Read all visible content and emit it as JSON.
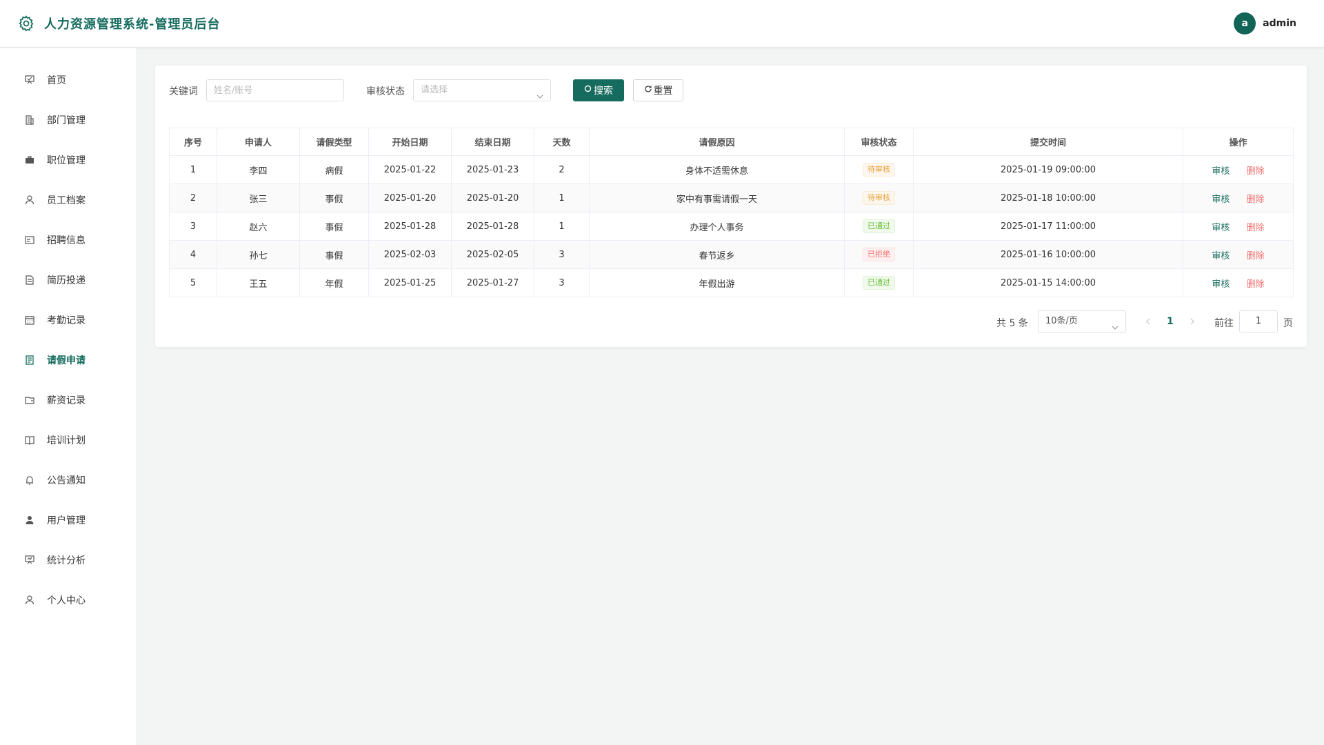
{
  "header": {
    "logo_icon": "gear-icon",
    "title": "人力资源管理系统-管理员后台",
    "avatar_letter": "a",
    "username": "admin"
  },
  "sidebar": {
    "items": [
      {
        "label": "首页",
        "icon": "presentation-board-icon"
      },
      {
        "label": "部门管理",
        "icon": "building-icon"
      },
      {
        "label": "职位管理",
        "icon": "briefcase-icon"
      },
      {
        "label": "员工档案",
        "icon": "user-icon"
      },
      {
        "label": "招聘信息",
        "icon": "postcard-icon"
      },
      {
        "label": "简历投递",
        "icon": "document-icon"
      },
      {
        "label": "考勤记录",
        "icon": "calendar-icon"
      },
      {
        "label": "请假申请",
        "icon": "tickets-icon",
        "active": true
      },
      {
        "label": "薪资记录",
        "icon": "wallet-icon"
      },
      {
        "label": "培训计划",
        "icon": "reading-icon"
      },
      {
        "label": "公告通知",
        "icon": "bell-icon"
      },
      {
        "label": "用户管理",
        "icon": "user-filled-icon"
      },
      {
        "label": "统计分析",
        "icon": "data-board-icon"
      },
      {
        "label": "个人中心",
        "icon": "user-icon"
      }
    ]
  },
  "filters": {
    "keyword_label": "关键词",
    "keyword_placeholder": "姓名/账号",
    "status_label": "审核状态",
    "status_placeholder": "请选择",
    "search_button": "搜索",
    "reset_button": "重置"
  },
  "table": {
    "columns": [
      "序号",
      "申请人",
      "请假类型",
      "开始日期",
      "结束日期",
      "天数",
      "请假原因",
      "审核状态",
      "提交时间",
      "操作"
    ],
    "rows": [
      {
        "index": "1",
        "applicant": "李四",
        "type": "病假",
        "start": "2025-01-22",
        "end": "2025-01-23",
        "days": "2",
        "reason": "身体不适需休息",
        "status": "待审核",
        "status_kind": "warning",
        "submitted": "2025-01-19 09:00:00"
      },
      {
        "index": "2",
        "applicant": "张三",
        "type": "事假",
        "start": "2025-01-20",
        "end": "2025-01-20",
        "days": "1",
        "reason": "家中有事需请假一天",
        "status": "待审核",
        "status_kind": "warning",
        "submitted": "2025-01-18 10:00:00"
      },
      {
        "index": "3",
        "applicant": "赵六",
        "type": "事假",
        "start": "2025-01-28",
        "end": "2025-01-28",
        "days": "1",
        "reason": "办理个人事务",
        "status": "已通过",
        "status_kind": "success",
        "submitted": "2025-01-17 11:00:00"
      },
      {
        "index": "4",
        "applicant": "孙七",
        "type": "事假",
        "start": "2025-02-03",
        "end": "2025-02-05",
        "days": "3",
        "reason": "春节返乡",
        "status": "已拒绝",
        "status_kind": "danger",
        "submitted": "2025-01-16 10:00:00"
      },
      {
        "index": "5",
        "applicant": "王五",
        "type": "年假",
        "start": "2025-01-25",
        "end": "2025-01-27",
        "days": "3",
        "reason": "年假出游",
        "status": "已通过",
        "status_kind": "success",
        "submitted": "2025-01-15 14:00:00"
      }
    ],
    "op_audit": "审核",
    "op_delete": "删除"
  },
  "pagination": {
    "total_text": "共 5 条",
    "page_size": "10条/页",
    "current_page": "1",
    "goto_label": "前往",
    "goto_value": "1",
    "page_suffix": "页"
  },
  "colors": {
    "primary": "#156b5e",
    "warning": "#e6a23c",
    "success": "#67c23a",
    "danger": "#f56c6c"
  }
}
